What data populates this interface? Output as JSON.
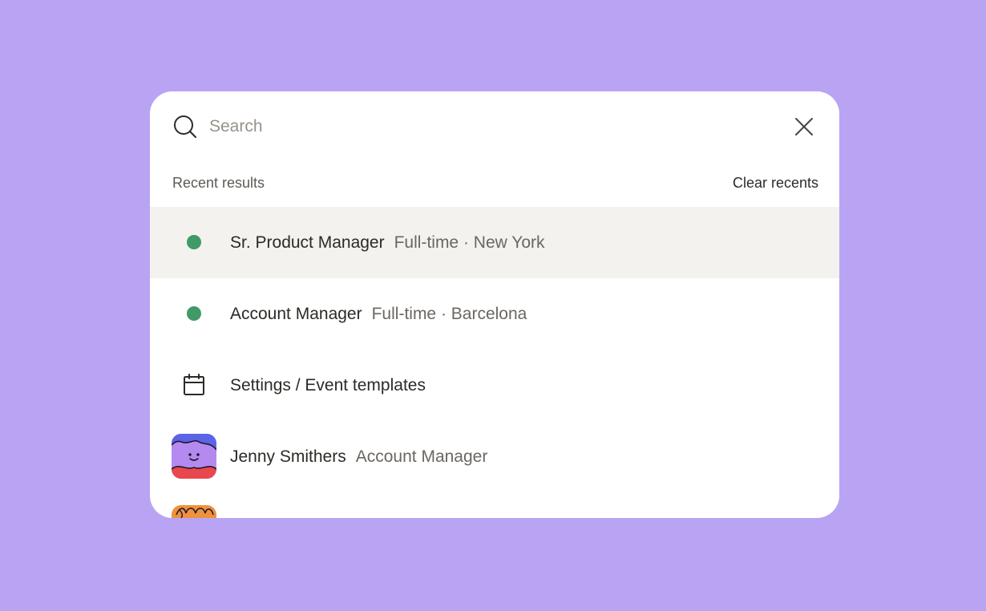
{
  "search": {
    "placeholder": "Search",
    "value": ""
  },
  "section": {
    "title": "Recent results",
    "clear_label": "Clear recents"
  },
  "results": [
    {
      "type": "job",
      "title": "Sr. Product Manager",
      "subtitle": "Full-time · New York",
      "status_color": "#3f9a68",
      "highlighted": true
    },
    {
      "type": "job",
      "title": "Account Manager",
      "subtitle": "Full-time · Barcelona",
      "status_color": "#3f9a68",
      "highlighted": false
    },
    {
      "type": "page",
      "icon": "calendar-icon",
      "title": "Settings / Event templates"
    },
    {
      "type": "person",
      "icon": "avatar",
      "title": "Jenny Smithers",
      "subtitle": "Account Manager"
    },
    {
      "type": "person",
      "icon": "avatar",
      "title": "",
      "subtitle": ""
    }
  ],
  "colors": {
    "background": "#b9a4f3",
    "highlight": "#f3f2ee",
    "status_green": "#3f9a68",
    "avatar_blue": "#5b63e6",
    "avatar_purple": "#b48af0",
    "avatar_red": "#e8474c",
    "avatar_orange": "#f0913c"
  }
}
